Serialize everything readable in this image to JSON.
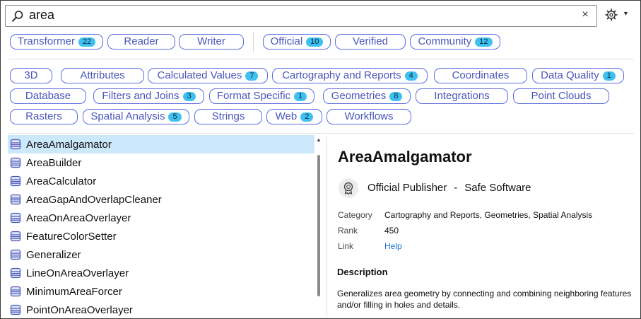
{
  "search": {
    "value": "area",
    "clear_label": "×"
  },
  "filters_row1": [
    {
      "label": "Transformer",
      "count": "22"
    },
    {
      "label": "Reader",
      "count": ""
    },
    {
      "label": "Writer",
      "count": ""
    },
    {
      "label": "Official",
      "count": "10"
    },
    {
      "label": "Verified",
      "count": ""
    },
    {
      "label": "Community",
      "count": "12"
    }
  ],
  "categories": [
    {
      "label": "3D",
      "count": ""
    },
    {
      "label": "Attributes",
      "count": ""
    },
    {
      "label": "Calculated Values",
      "count": "7"
    },
    {
      "label": "Cartography and Reports",
      "count": "4"
    },
    {
      "label": "Coordinates",
      "count": ""
    },
    {
      "label": "Data Quality",
      "count": "1"
    },
    {
      "label": "Database",
      "count": ""
    },
    {
      "label": "Filters and Joins",
      "count": "3"
    },
    {
      "label": "Format Specific",
      "count": "1"
    },
    {
      "label": "Geometries",
      "count": "8"
    },
    {
      "label": "Integrations",
      "count": ""
    },
    {
      "label": "Point Clouds",
      "count": ""
    },
    {
      "label": "Rasters",
      "count": ""
    },
    {
      "label": "Spatial Analysis",
      "count": "5"
    },
    {
      "label": "Strings",
      "count": ""
    },
    {
      "label": "Web",
      "count": "2"
    },
    {
      "label": "Workflows",
      "count": ""
    }
  ],
  "results": [
    "AreaAmalgamator",
    "AreaBuilder",
    "AreaCalculator",
    "AreaGapAndOverlapCleaner",
    "AreaOnAreaOverlayer",
    "FeatureColorSetter",
    "Generalizer",
    "LineOnAreaOverlayer",
    "MinimumAreaForcer",
    "PointOnAreaOverlayer"
  ],
  "selected_index": 0,
  "detail": {
    "title": "AreaAmalgamator",
    "publisher_type": "Official Publisher",
    "dash": "-",
    "publisher_name": "Safe Software",
    "category_label": "Category",
    "category_value": "Cartography and Reports, Geometries, Spatial Analysis",
    "rank_label": "Rank",
    "rank_value": "450",
    "link_label": "Link",
    "link_value": "Help",
    "description_title": "Description",
    "description": "Generalizes area geometry by connecting and combining neighboring features and/or filling in holes and details."
  },
  "colors": {
    "chip_border": "#5b6ddd",
    "chip_text": "#4a57b7",
    "badge_bg": "#3ec1f0",
    "selection_bg": "#cce8fb",
    "link": "#1a6fc7"
  },
  "icons": {
    "search": "search-icon",
    "settings": "gear-icon",
    "list_item": "transformer-icon",
    "publisher": "official-badge-icon"
  }
}
